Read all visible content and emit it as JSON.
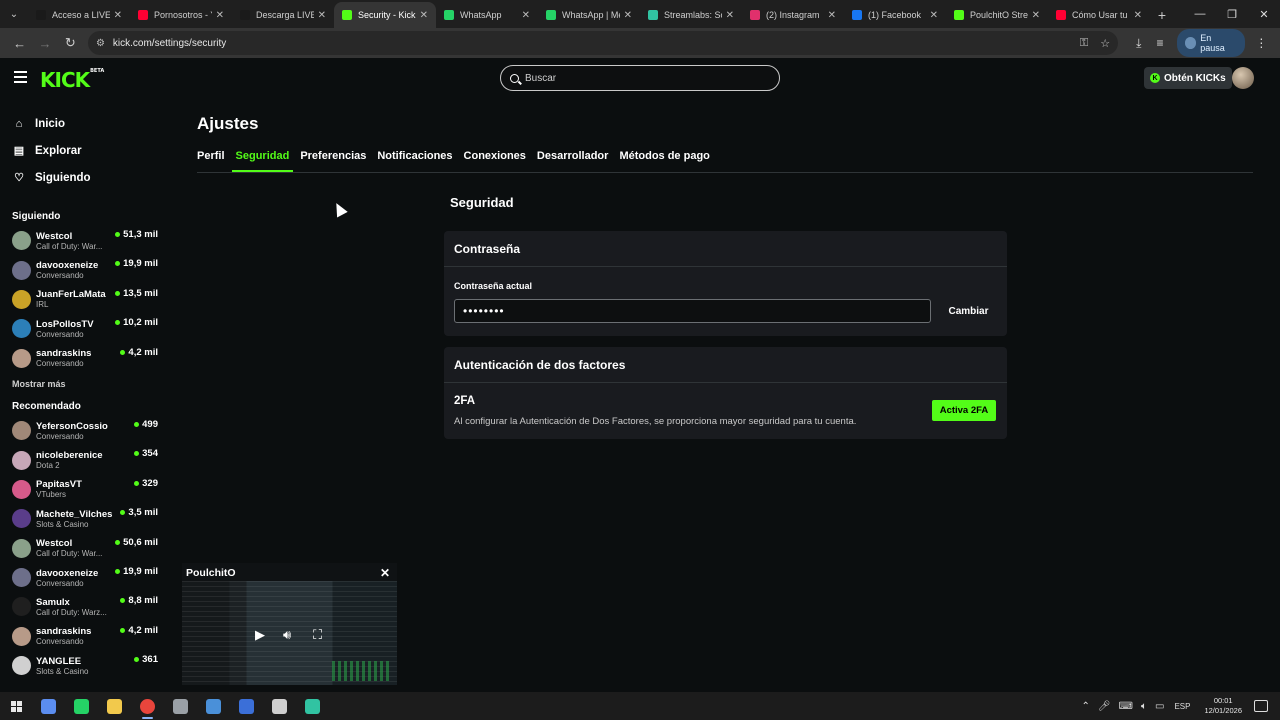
{
  "browser": {
    "tabs": [
      {
        "title": "Acceso a LIVE",
        "color": "#1a1a1a"
      },
      {
        "title": "Pornosotros - Y",
        "color": "#ff0033"
      },
      {
        "title": "Descarga LIVE",
        "color": "#1a1a1a"
      },
      {
        "title": "Security - Kick",
        "color": "#53fc18"
      },
      {
        "title": "WhatsApp",
        "color": "#25d366"
      },
      {
        "title": "WhatsApp | Me",
        "color": "#25d366"
      },
      {
        "title": "Streamlabs: So",
        "color": "#31c3a2"
      },
      {
        "title": "(2) Instagram",
        "color": "#e1306c"
      },
      {
        "title": "(1) Facebook",
        "color": "#1877f2"
      },
      {
        "title": "PoulchitO Stre",
        "color": "#53fc18"
      },
      {
        "title": "Cómo Usar tu",
        "color": "#ff0033"
      }
    ],
    "url": "kick.com/settings/security",
    "profile_status": "En pausa"
  },
  "header": {
    "logo": "KICK",
    "logo_badge": "BETA",
    "search_placeholder": "Buscar",
    "kicks_button": "Obtén KICKs"
  },
  "sidebar": {
    "nav": [
      {
        "label": "Inicio",
        "icon": "home-icon"
      },
      {
        "label": "Explorar",
        "icon": "browse-icon"
      },
      {
        "label": "Siguiendo",
        "icon": "heart-icon"
      }
    ],
    "following_title": "Siguiendo",
    "following": [
      {
        "name": "Westcol",
        "category": "Call of Duty: War...",
        "viewers": "51,3 mil",
        "color": "#8aa08a"
      },
      {
        "name": "davooxeneize",
        "category": "Conversando",
        "viewers": "19,9 mil",
        "color": "#6d6f8a"
      },
      {
        "name": "JuanFerLaMata",
        "category": "IRL",
        "viewers": "13,5 mil",
        "color": "#c9a227"
      },
      {
        "name": "LosPollosTV",
        "category": "Conversando",
        "viewers": "10,2 mil",
        "color": "#2c7fb8"
      },
      {
        "name": "sandraskins",
        "category": "Conversando",
        "viewers": "4,2 mil",
        "color": "#b79a88"
      }
    ],
    "show_more": "Mostrar más",
    "recommended_title": "Recomendado",
    "recommended": [
      {
        "name": "YefersonCossio",
        "category": "Conversando",
        "viewers": "499",
        "color": "#a08878"
      },
      {
        "name": "nicoleberenice",
        "category": "Dota 2",
        "viewers": "354",
        "color": "#c7a7b8"
      },
      {
        "name": "PapitasVT",
        "category": "VTubers",
        "viewers": "329",
        "color": "#d65a8a"
      },
      {
        "name": "Machete_Vilches",
        "category": "Slots & Casino",
        "viewers": "3,5 mil",
        "color": "#5a3d8a"
      },
      {
        "name": "Westcol",
        "category": "Call of Duty: War...",
        "viewers": "50,6 mil",
        "color": "#8aa08a"
      },
      {
        "name": "davooxeneize",
        "category": "Conversando",
        "viewers": "19,9 mil",
        "color": "#6d6f8a"
      },
      {
        "name": "Samulx",
        "category": "Call of Duty: Warz...",
        "viewers": "8,8 mil",
        "color": "#1f1f1f"
      },
      {
        "name": "sandraskins",
        "category": "Conversando",
        "viewers": "4,2 mil",
        "color": "#b79a88"
      },
      {
        "name": "YANGLEE",
        "category": "Slots & Casino",
        "viewers": "361",
        "color": "#d0d0d0"
      }
    ]
  },
  "settings": {
    "title": "Ajustes",
    "tabs": [
      "Perfil",
      "Seguridad",
      "Preferencias",
      "Notificaciones",
      "Conexiones",
      "Desarrollador",
      "Métodos de pago"
    ],
    "active_tab": "Seguridad",
    "section_title": "Seguridad",
    "password": {
      "card_title": "Contraseña",
      "label": "Contraseña actual",
      "value": "••••••••",
      "button": "Cambiar"
    },
    "twofa": {
      "card_title": "Autenticación de dos factores",
      "name": "2FA",
      "description": "Al configurar la Autenticación de Dos Factores, se proporciona mayor seguridad para tu cuenta.",
      "button": "Activa 2FA"
    }
  },
  "mini_player": {
    "title": "PoulchitO"
  },
  "taskbar": {
    "apps": [
      {
        "name": "copilot",
        "color": "#5b8def"
      },
      {
        "name": "whatsapp",
        "color": "#25d366"
      },
      {
        "name": "file-explorer",
        "color": "#f2c94c"
      },
      {
        "name": "chrome",
        "color": "#e8453c",
        "active": true
      },
      {
        "name": "app-5",
        "color": "#9aa0a6"
      },
      {
        "name": "app-6",
        "color": "#4a90d9"
      },
      {
        "name": "app-7",
        "color": "#3b6fd8"
      },
      {
        "name": "settings",
        "color": "#cfcfcf"
      },
      {
        "name": "streamlabs",
        "color": "#31c3a2"
      }
    ],
    "language": "ESP",
    "time": "00:01",
    "date": "12/01/2026"
  },
  "colors": {
    "accent": "#53fc18",
    "background": "#0b0e0f",
    "card": "#191b1f"
  }
}
